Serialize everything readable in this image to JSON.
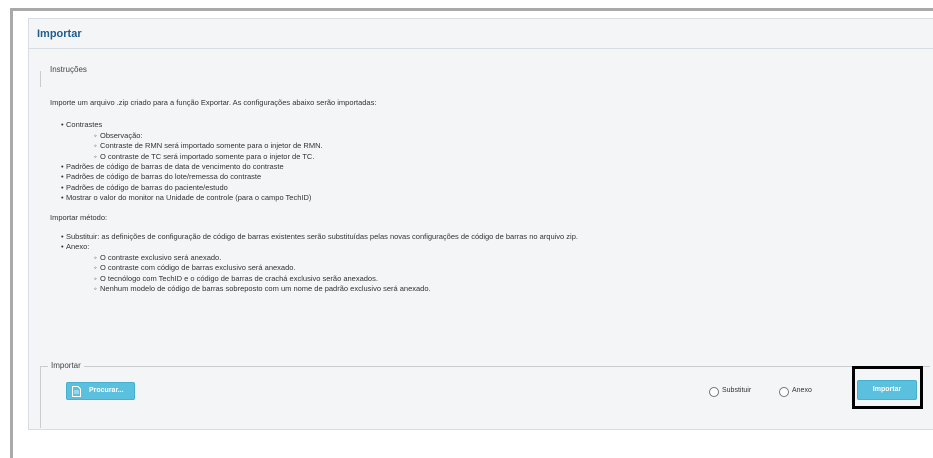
{
  "panel": {
    "title": "Importar"
  },
  "instructions": {
    "legend": "Instruções",
    "intro": "Importe um arquivo .zip criado para a função Exportar. As configurações abaixo serão importadas:",
    "items": [
      {
        "level": 1,
        "text": "Contrastes"
      },
      {
        "level": 2,
        "text": "Observação:"
      },
      {
        "level": 2,
        "text": "Contraste de RMN será importado somente para o injetor de RMN."
      },
      {
        "level": 2,
        "text": "O contraste de TC será importado somente para o injetor de TC."
      },
      {
        "level": 1,
        "text": "Padrões de código de barras de data de vencimento do contraste"
      },
      {
        "level": 1,
        "text": "Padrões de código de barras do lote/remessa do contraste"
      },
      {
        "level": 1,
        "text": "Padrões de código de barras do paciente/estudo"
      },
      {
        "level": 1,
        "text": "Mostrar o valor do monitor na Unidade de controle (para o campo TechID)"
      }
    ],
    "method_heading": "Importar método:",
    "method_items": [
      {
        "level": 1,
        "text": "Substituir: as definições de configuração de código de barras existentes serão substituídas pelas novas configurações de código de barras no arquivo zip."
      },
      {
        "level": 1,
        "text": "Anexo:"
      },
      {
        "level": 2,
        "text": "O contraste exclusivo será anexado."
      },
      {
        "level": 2,
        "text": "O contraste com código de barras exclusivo será anexado."
      },
      {
        "level": 2,
        "text": "O tecnólogo com TechID e o código de barras de crachá exclusivo serão anexados."
      },
      {
        "level": 2,
        "text": "Nenhum modelo de código de barras sobreposto com um nome de padrão exclusivo será anexado."
      }
    ]
  },
  "import_section": {
    "legend": "Importar",
    "browse_label": "Procurar...",
    "radio_replace": "Substituir",
    "radio_append": "Anexo",
    "import_label": "Importar"
  },
  "colors": {
    "accent": "#5bc0de",
    "title": "#1f5d8d",
    "panel_bg": "#f4f5f7"
  }
}
